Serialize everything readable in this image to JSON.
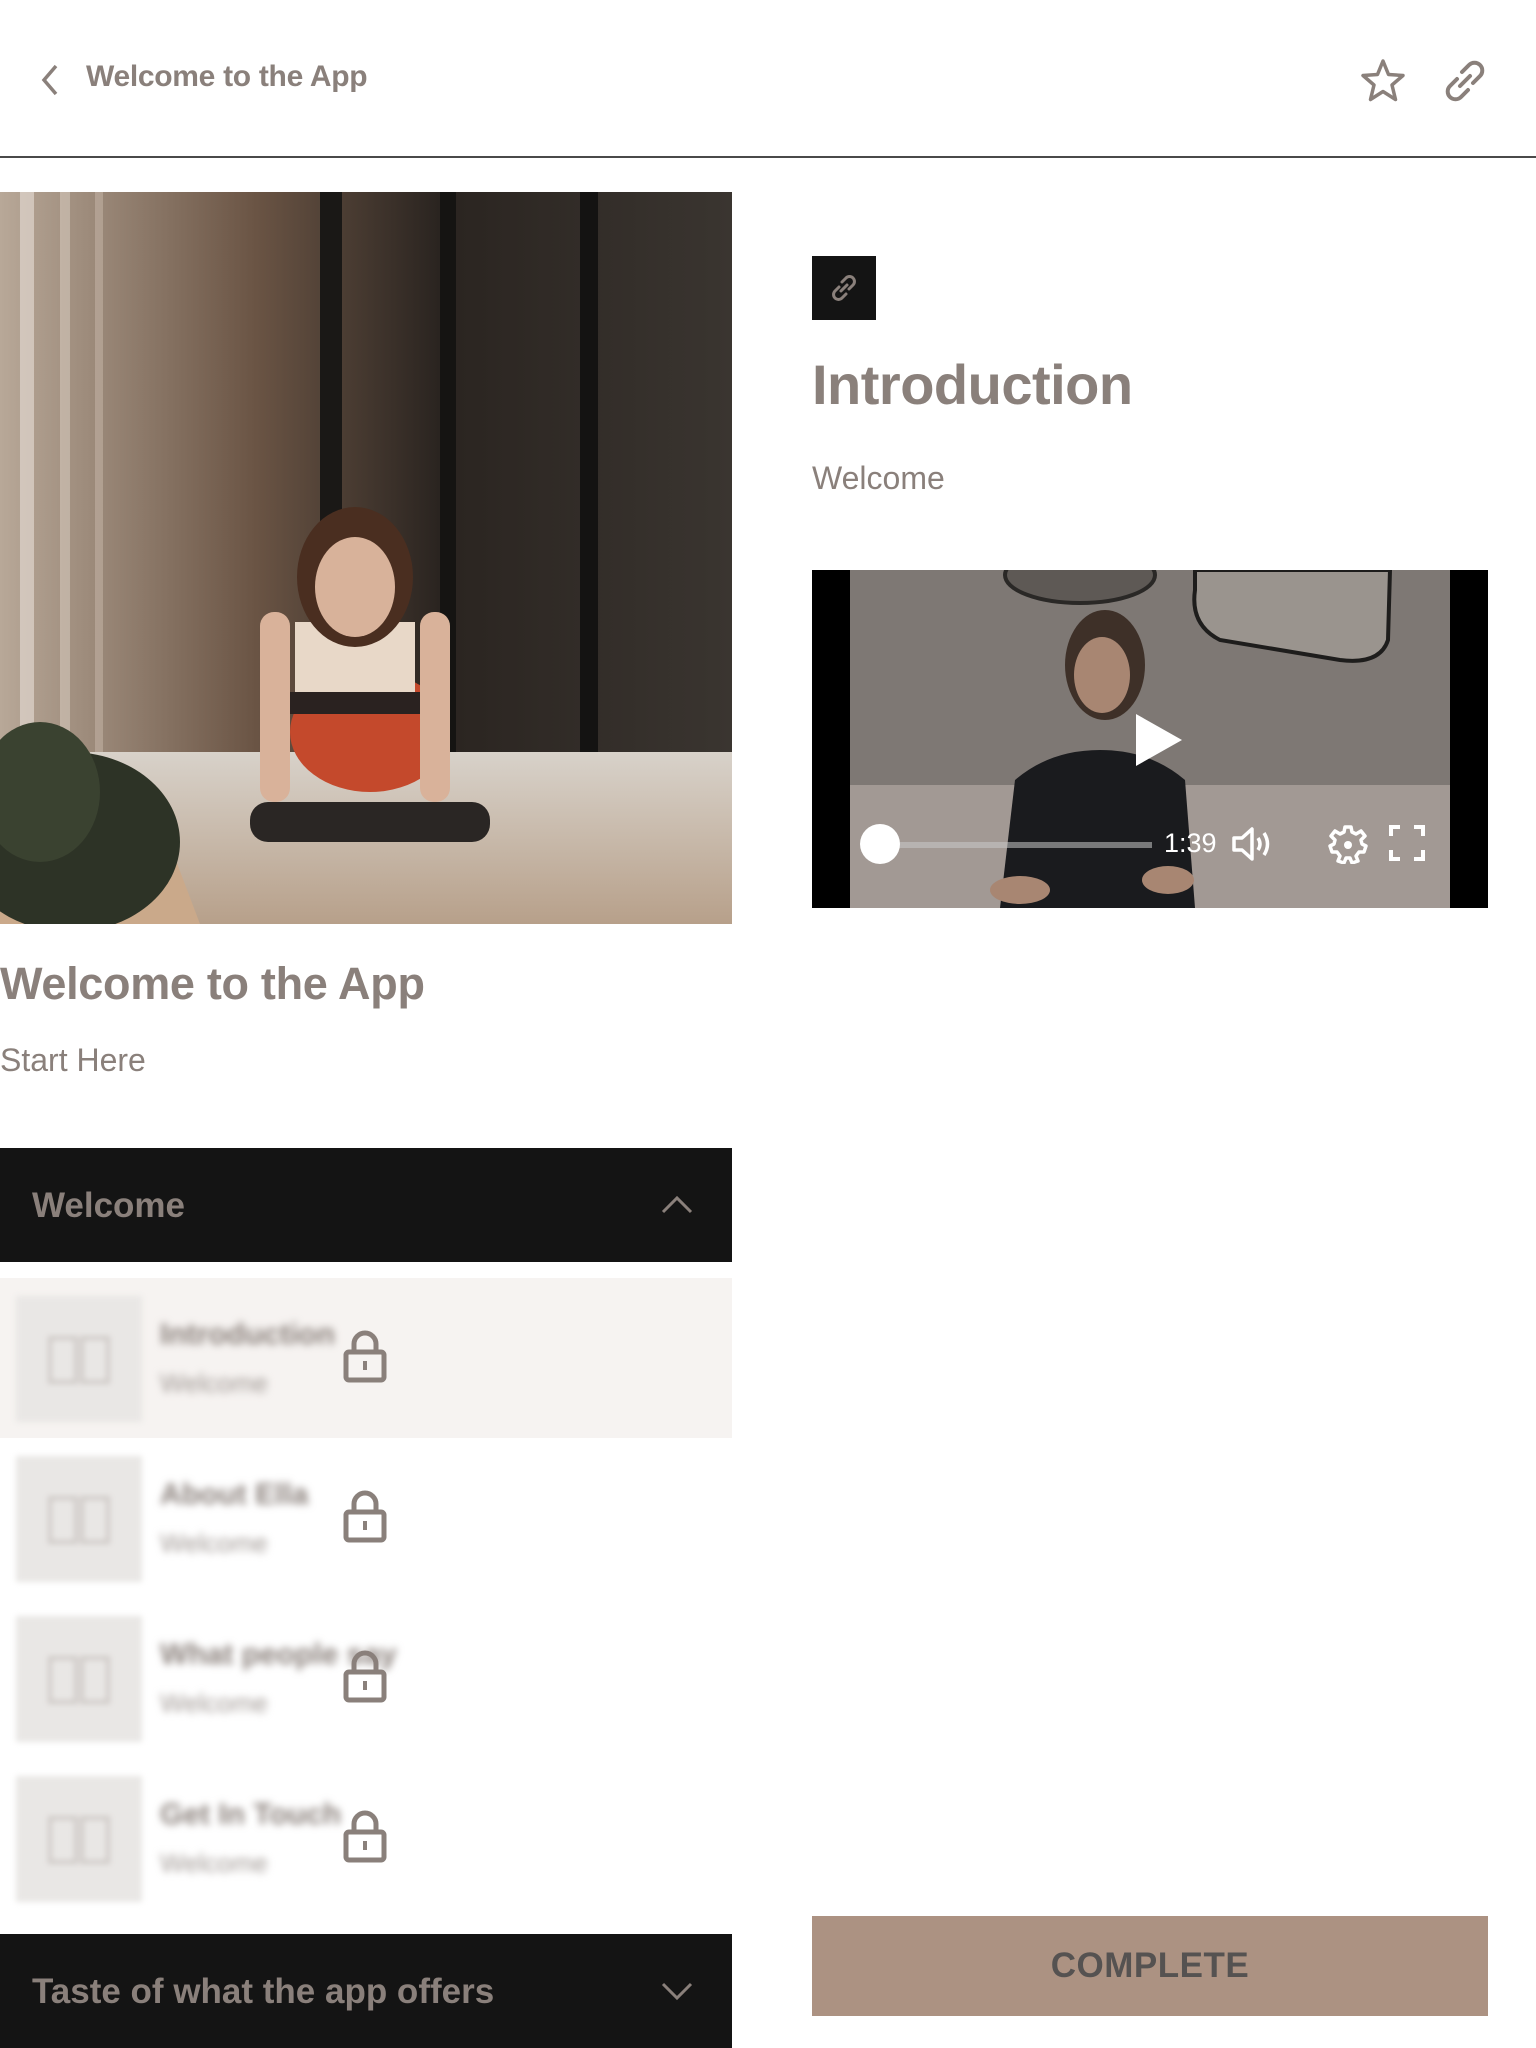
{
  "header": {
    "title": "Welcome to the App",
    "back_icon": "chevron-left-icon",
    "favorite_icon": "star-icon",
    "share_icon": "link-icon"
  },
  "course": {
    "hero_image": "woman-rolling-yoga-mat-photo",
    "title": "Welcome to the App",
    "subtitle": "Start Here"
  },
  "sections": [
    {
      "label": "Welcome",
      "expanded": true,
      "chevron_icon": "chevron-up-icon",
      "lessons": [
        {
          "title": "Introduction",
          "subtitle": "Welcome",
          "locked": true,
          "active": true,
          "icon": "book-icon"
        },
        {
          "title": "About Ella",
          "subtitle": "Welcome",
          "locked": true,
          "active": false,
          "icon": "book-icon"
        },
        {
          "title": "What people say",
          "subtitle": "Welcome",
          "locked": true,
          "active": false,
          "icon": "book-icon"
        },
        {
          "title": "Get In Touch",
          "subtitle": "Welcome",
          "locked": true,
          "active": false,
          "icon": "book-icon"
        }
      ]
    },
    {
      "label": "Taste of what the app offers",
      "expanded": false,
      "chevron_icon": "chevron-down-icon"
    }
  ],
  "lesson": {
    "type_icon": "link-icon",
    "title": "Introduction",
    "subtitle": "Welcome"
  },
  "video": {
    "duration": "1:39",
    "progress": 0,
    "controls": [
      "play-icon",
      "volume-icon",
      "settings-icon",
      "fullscreen-icon"
    ]
  },
  "actions": {
    "complete_label": "COMPLETE"
  },
  "colors": {
    "text": "#8a807b",
    "dark": "#141414",
    "accent": "#ac9282",
    "active_row": "#f6f3f1"
  }
}
